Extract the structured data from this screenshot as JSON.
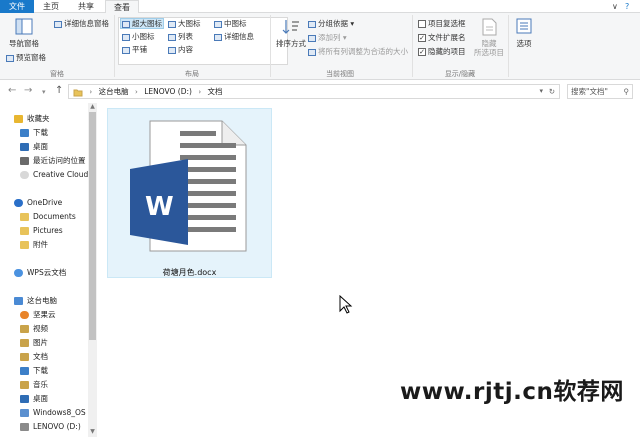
{
  "ribbon_tabs": {
    "file": "文件",
    "home": "主页",
    "share": "共享",
    "view": "查看"
  },
  "window_controls": {
    "collapse": "∨",
    "help": "?"
  },
  "ribbon": {
    "panes": {
      "nav_pane": "导航窗格",
      "preview_pane": "预览窗格",
      "details_pane": "详细信息窗格",
      "group_label": "窗格"
    },
    "layout": {
      "extra_large": "超大图标",
      "large": "大图标",
      "medium": "中图标",
      "small": "小图标",
      "list": "列表",
      "details": "详细信息",
      "tiles": "平铺",
      "content": "内容",
      "group_label": "布局"
    },
    "current_view": {
      "sort_by": "排序方式",
      "group_by": "分组依据",
      "add_columns": "添加列",
      "size_columns": "将所有列调整为合适的大小",
      "group_label": "当前视图"
    },
    "show_hide": {
      "item_checkboxes": "项目复选框",
      "file_extensions": "文件扩展名",
      "hidden_items": "隐藏的项目",
      "hide_selected": "隐藏",
      "selected_items": "所选项目",
      "group_label": "显示/隐藏",
      "item_checkboxes_checked": false,
      "file_extensions_checked": true,
      "hidden_items_checked": true
    },
    "options": "选项"
  },
  "address": {
    "crumbs": [
      "这台电脑",
      "LENOVO (D:)",
      "文档"
    ],
    "search_placeholder": "搜索\"文档\"",
    "refresh_icon": "↻"
  },
  "navpane": {
    "items": [
      {
        "label": "收藏夹",
        "icon": "star-icon",
        "color": "#e8b630"
      },
      {
        "label": "下载",
        "icon": "download-folder-icon",
        "color": "#3c7fc8"
      },
      {
        "label": "桌面",
        "icon": "desktop-icon",
        "color": "#2f6db5"
      },
      {
        "label": "最近访问的位置",
        "icon": "recent-icon",
        "color": "#6a6a6a"
      },
      {
        "label": "Creative Cloud",
        "icon": "creative-cloud-icon",
        "color": "#d8d8d8"
      },
      {
        "label": "OneDrive",
        "icon": "onedrive-icon",
        "color": "#2a6fc8"
      },
      {
        "label": "Documents",
        "icon": "folder-icon",
        "color": "#e8c35a"
      },
      {
        "label": "Pictures",
        "icon": "folder-icon",
        "color": "#e8c35a"
      },
      {
        "label": "附件",
        "icon": "folder-icon",
        "color": "#e8c35a"
      },
      {
        "label": "WPS云文档",
        "icon": "wps-cloud-icon",
        "color": "#4b92e0"
      },
      {
        "label": "这台电脑",
        "icon": "computer-icon",
        "color": "#4a8ad4"
      },
      {
        "label": "坚果云",
        "icon": "nutstore-icon",
        "color": "#e8842a"
      },
      {
        "label": "视频",
        "icon": "videos-icon",
        "color": "#c9a34a"
      },
      {
        "label": "图片",
        "icon": "pictures-icon",
        "color": "#c9a34a"
      },
      {
        "label": "文档",
        "icon": "documents-icon",
        "color": "#c9a34a"
      },
      {
        "label": "下载",
        "icon": "download-folder-icon",
        "color": "#3c7fc8"
      },
      {
        "label": "音乐",
        "icon": "music-icon",
        "color": "#c9a34a"
      },
      {
        "label": "桌面",
        "icon": "desktop-icon",
        "color": "#2f6db5"
      },
      {
        "label": "Windows8_OS",
        "icon": "drive-os-icon",
        "color": "#5a8fcf"
      },
      {
        "label": "LENOVO (D:)",
        "icon": "drive-icon",
        "color": "#8a8a8a"
      }
    ]
  },
  "file": {
    "name": "荷塘月色.docx",
    "icon": "word-document-icon",
    "accent": "#2b579a"
  },
  "watermark": "www.rjtj.cn软荐网"
}
